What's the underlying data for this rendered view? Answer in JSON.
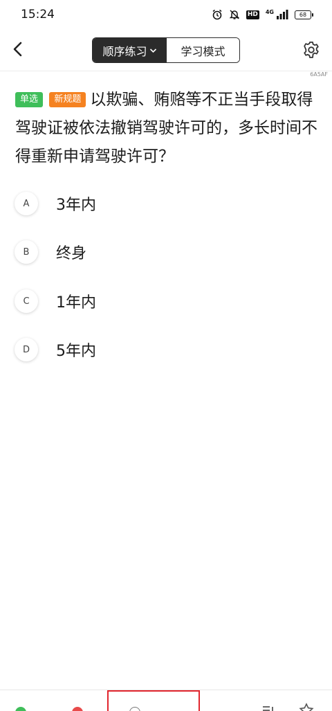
{
  "status_bar": {
    "time": "15:24",
    "hd_label": "HD",
    "network_label": "4G",
    "battery_level": "68"
  },
  "nav": {
    "mode_active": "顺序练习",
    "mode_inactive": "学习模式"
  },
  "question": {
    "id_label": "6A5AF",
    "type_tag": "单选",
    "new_tag": "新规题",
    "text": "以欺骗、贿赂等不正当手段取得驾驶证被依法撤销驾驶许可的，多长时间不得重新申请驾驶许可？",
    "options": [
      {
        "letter": "A",
        "text": "3年内"
      },
      {
        "letter": "B",
        "text": "终身"
      },
      {
        "letter": "C",
        "text": "1年内"
      },
      {
        "letter": "D",
        "text": "5年内"
      }
    ]
  },
  "colors": {
    "single_tag": "#3fbe5a",
    "new_tag": "#f58220",
    "highlight": "#e1252d"
  }
}
